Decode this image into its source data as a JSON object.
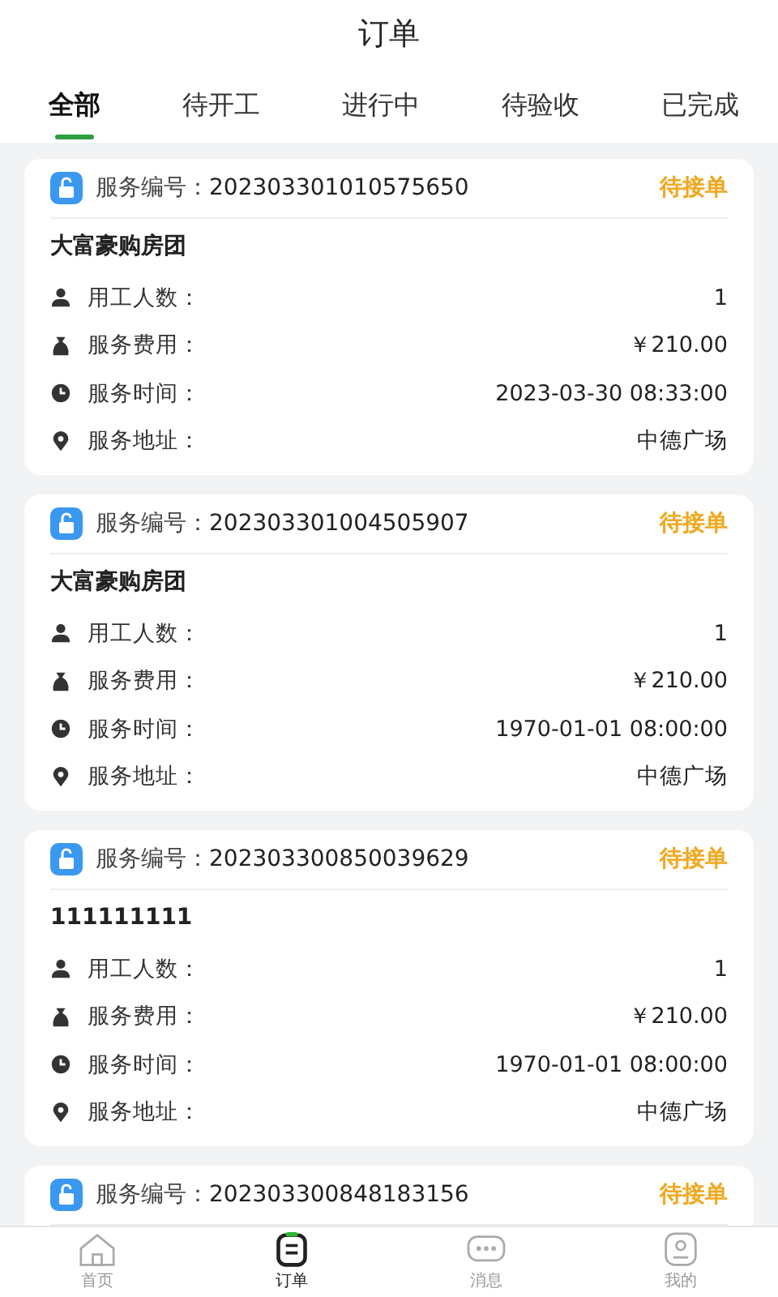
{
  "title": "订单",
  "tabs": [
    {
      "label": "全部",
      "selected": true
    },
    {
      "label": "待开工",
      "selected": false
    },
    {
      "label": "进行中",
      "selected": false
    },
    {
      "label": "待验收",
      "selected": false
    },
    {
      "label": "已完成",
      "selected": false
    }
  ],
  "orders": [
    {
      "number_label": "服务编号：",
      "number": "202303301010575650",
      "status": "待接单",
      "name": "大富豪购房团",
      "fields": [
        {
          "kind": "workers",
          "label": "用工人数：",
          "value": "1"
        },
        {
          "kind": "fee",
          "label": "服务费用：",
          "value": "￥210.00"
        },
        {
          "kind": "time",
          "label": "服务时间：",
          "value": "2023-03-30 08:33:00"
        },
        {
          "kind": "address",
          "label": "服务地址：",
          "value": "中德广场"
        }
      ]
    },
    {
      "number_label": "服务编号：",
      "number": "202303301004505907",
      "status": "待接单",
      "name": "大富豪购房团",
      "fields": [
        {
          "kind": "workers",
          "label": "用工人数：",
          "value": "1"
        },
        {
          "kind": "fee",
          "label": "服务费用：",
          "value": "￥210.00"
        },
        {
          "kind": "time",
          "label": "服务时间：",
          "value": "1970-01-01 08:00:00"
        },
        {
          "kind": "address",
          "label": "服务地址：",
          "value": "中德广场"
        }
      ]
    },
    {
      "number_label": "服务编号：",
      "number": "202303300850039629",
      "status": "待接单",
      "name": "111111111",
      "fields": [
        {
          "kind": "workers",
          "label": "用工人数：",
          "value": "1"
        },
        {
          "kind": "fee",
          "label": "服务费用：",
          "value": "￥210.00"
        },
        {
          "kind": "time",
          "label": "服务时间：",
          "value": "1970-01-01 08:00:00"
        },
        {
          "kind": "address",
          "label": "服务地址：",
          "value": "中德广场"
        }
      ]
    },
    {
      "number_label": "服务编号：",
      "number": "202303300848183156",
      "status": "待接单"
    }
  ],
  "nav": [
    {
      "kind": "home",
      "label": "首页",
      "selected": false
    },
    {
      "kind": "orders",
      "label": "订单",
      "selected": true
    },
    {
      "kind": "messages",
      "label": "消息",
      "selected": false
    },
    {
      "kind": "profile",
      "label": "我的",
      "selected": false
    }
  ]
}
